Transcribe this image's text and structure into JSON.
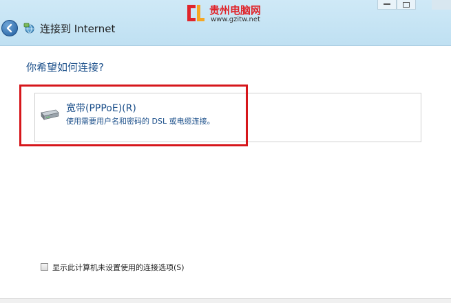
{
  "window": {
    "title": "连接到 Internet"
  },
  "watermark": {
    "site_name": "贵州电脑网",
    "url": "www.gzitw.net"
  },
  "content": {
    "heading": "你希望如何连接?",
    "options": [
      {
        "title": "宽带(PPPoE)(R)",
        "description": "使用需要用户名和密码的 DSL 或电缆连接。",
        "icon": "modem-icon"
      }
    ],
    "show_unconfigured_checkbox": {
      "label": "显示此计算机未设置使用的连接选项(S)",
      "checked": false
    }
  },
  "colors": {
    "title_bar": "#bfe0f2",
    "heading_text": "#1b4f8a",
    "highlight_border": "#d6161b",
    "watermark_red": "#e0252b"
  }
}
